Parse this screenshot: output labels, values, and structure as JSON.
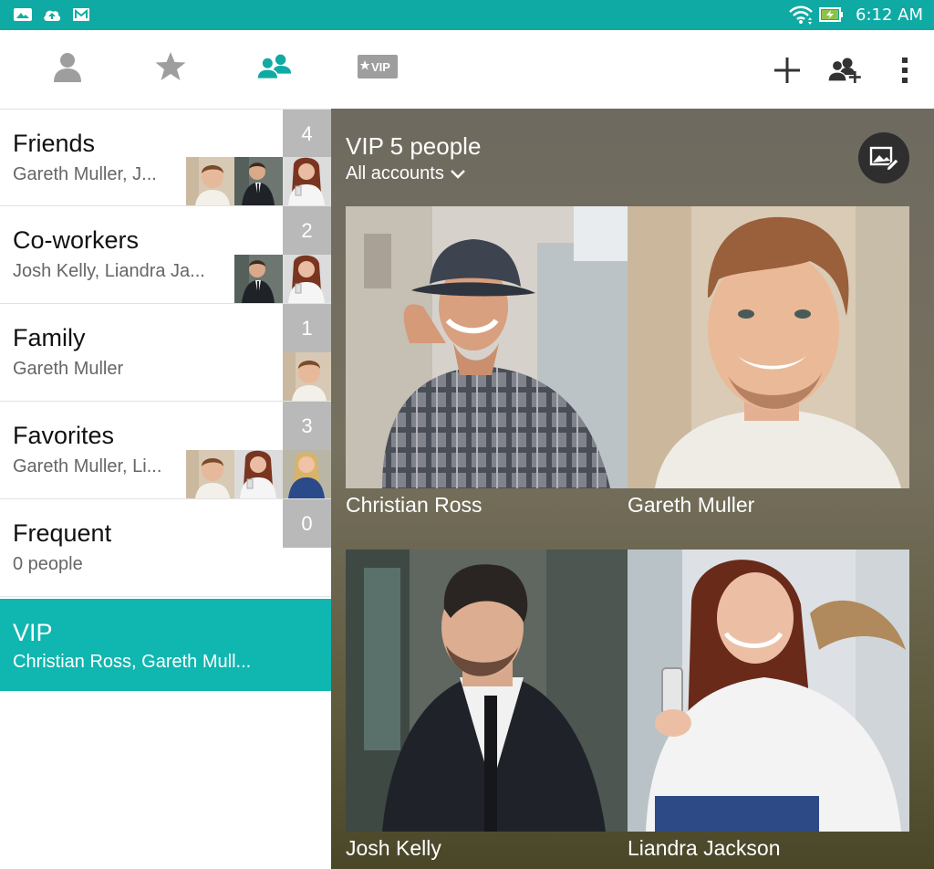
{
  "status_bar": {
    "time": "6:12 AM",
    "left_icons": [
      "gallery-icon",
      "cloud-upload-icon",
      "mail-icon"
    ],
    "right_icons": [
      "wifi-icon",
      "battery-charging-icon"
    ]
  },
  "toolbar": {
    "tabs": [
      {
        "name": "contacts",
        "icon": "person-icon",
        "active": false
      },
      {
        "name": "favorites",
        "icon": "star-icon",
        "active": false
      },
      {
        "name": "groups",
        "icon": "group-icon",
        "active": true
      },
      {
        "name": "vip",
        "icon": "vip-icon",
        "label": "VIP",
        "active": false
      }
    ],
    "actions": [
      "add-icon",
      "add-group-member-icon",
      "overflow-menu-icon"
    ]
  },
  "groups": [
    {
      "name": "Friends",
      "members": "Gareth Muller, J...",
      "count": "4",
      "thumbs": [
        "gareth",
        "josh",
        "liandra"
      ]
    },
    {
      "name": "Co-workers",
      "members": "Josh Kelly, Liandra Ja...",
      "count": "2",
      "thumbs": [
        "josh",
        "liandra"
      ]
    },
    {
      "name": "Family",
      "members": "Gareth Muller",
      "count": "1",
      "thumbs": [
        "gareth"
      ]
    },
    {
      "name": "Favorites",
      "members": "Gareth Muller, Li...",
      "count": "3",
      "thumbs": [
        "gareth",
        "liandra",
        "christian"
      ]
    },
    {
      "name": "Frequent",
      "members": "0 people",
      "count": "0",
      "thumbs": []
    },
    {
      "name": "VIP",
      "members": "Christian Ross, Gareth Mull...",
      "selected": true
    }
  ],
  "detail": {
    "title": "VIP 5 people",
    "account_filter": "All accounts",
    "people": [
      {
        "name": "Christian Ross"
      },
      {
        "name": "Gareth Muller"
      },
      {
        "name": "Josh Kelly"
      },
      {
        "name": "Liandra Jackson"
      }
    ]
  },
  "colors": {
    "accent": "#10b6b0",
    "status_bar": "#10aaa4",
    "count_badge": "#b9b9b9"
  }
}
